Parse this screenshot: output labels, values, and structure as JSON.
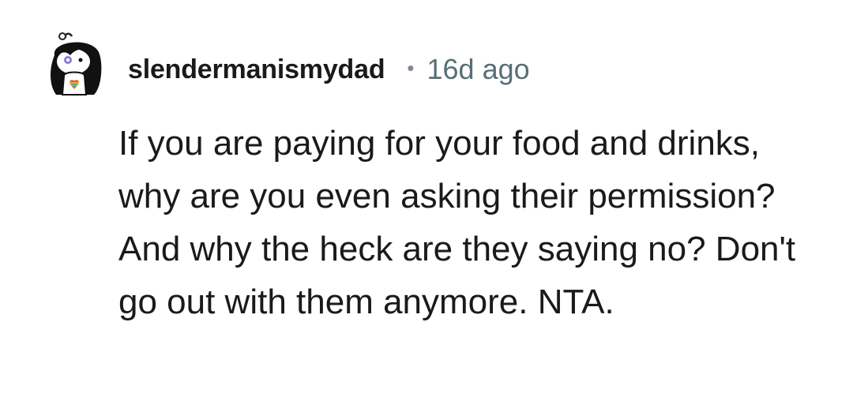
{
  "comment": {
    "avatar_icon": "snoo-avatar-icon",
    "username": "slendermanismydad",
    "separator": "•",
    "timestamp": "16d ago",
    "body": "If you are paying for your food and drinks, why are you even asking their permission? And why the heck are they saying no? Don't go out with them anymore. NTA."
  },
  "colors": {
    "username": "#1a1a1b",
    "timestamp": "#576f76",
    "body_text": "#1a1a1b",
    "background": "#ffffff"
  }
}
